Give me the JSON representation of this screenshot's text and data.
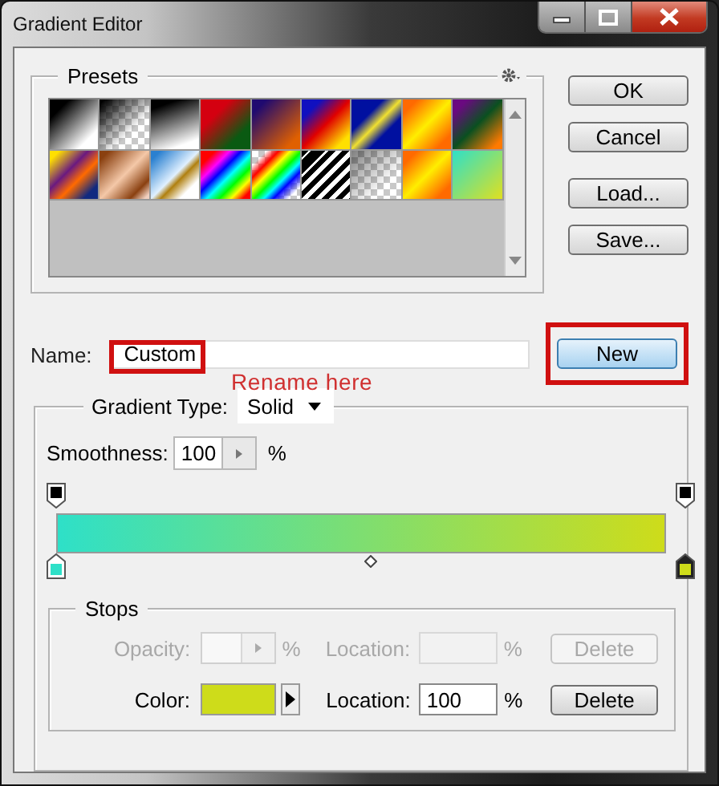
{
  "window": {
    "title": "Gradient Editor"
  },
  "presets": {
    "label": "Presets"
  },
  "buttons": [
    "OK",
    "Cancel",
    "Load...",
    "Save..."
  ],
  "name_field": {
    "label": "Name:",
    "value": "Custom"
  },
  "annotation": {
    "text": "Rename here"
  },
  "new_button": "New",
  "gradient_type": {
    "label": "Gradient Type:",
    "value": "Solid"
  },
  "smoothness": {
    "label": "Smoothness:",
    "value": "100",
    "unit": "%"
  },
  "opacity_stops": [
    {
      "selected": false
    },
    {
      "selected": false
    }
  ],
  "color_stops": [
    {
      "color": "#2ee0c8",
      "selected": false
    },
    {
      "color": "#cedc1a",
      "selected": true
    }
  ],
  "stops": {
    "label": "Stops",
    "rows": [
      {
        "kind": "opacity",
        "label": "Opacity:",
        "unit": "%",
        "location_label": "Location:",
        "location_unit": "%",
        "button": "Delete",
        "disabled": true
      },
      {
        "kind": "color",
        "label": "Color:",
        "color": "#cedc1a",
        "location_label": "Location:",
        "location_value": "100",
        "location_unit": "%",
        "button": "Delete",
        "disabled": false
      }
    ]
  }
}
